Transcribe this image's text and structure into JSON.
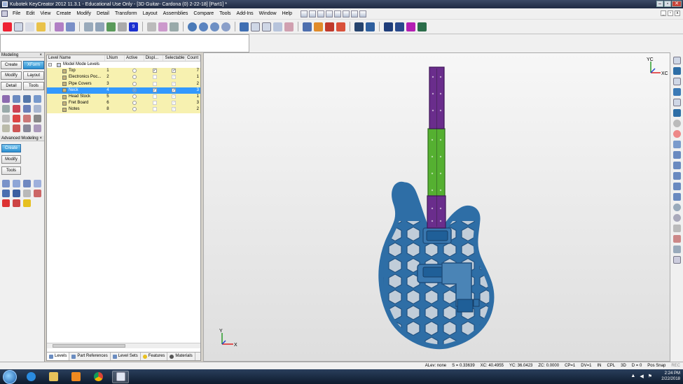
{
  "window": {
    "title": "Kubotek KeyCreator 2012 11.3.1 - Educational Use Only - [3D Guitar- Cardona (0) 2-22-18] [Part1] *"
  },
  "menu": [
    "File",
    "Edit",
    "View",
    "Create",
    "Modify",
    "Detail",
    "Transform",
    "Layout",
    "Assemblies",
    "Compare",
    "Tools",
    "Add-Ins",
    "Window",
    "Help"
  ],
  "left_panel": {
    "modeling_title": "Modeling",
    "modeling_buttons": [
      "Create",
      "XForm",
      "Modify",
      "Layout",
      "Detail",
      "Tools"
    ],
    "advanced_title": "Advanced Modeling",
    "advanced_buttons": [
      "Create",
      "Modify",
      "Tools"
    ]
  },
  "levels": {
    "headers": [
      "Level Name",
      "LNum",
      "Active",
      "Displ...",
      "Selectable",
      "Count"
    ],
    "root": "Model Mode Levels",
    "rows": [
      {
        "name": "Top",
        "lnum": "1",
        "count": "7",
        "active": false,
        "display": true,
        "selectable": true
      },
      {
        "name": "Electronics Poc...",
        "lnum": "2",
        "count": "1",
        "active": false,
        "display": false,
        "selectable": false
      },
      {
        "name": "Pipe Covers",
        "lnum": "3",
        "count": "2",
        "active": false,
        "display": false,
        "selectable": false
      },
      {
        "name": "Neck",
        "lnum": "4",
        "count": "3",
        "active": true,
        "display": true,
        "selectable": true
      },
      {
        "name": "Head Stock",
        "lnum": "5",
        "count": "1",
        "active": false,
        "display": false,
        "selectable": false
      },
      {
        "name": "Fret Board",
        "lnum": "6",
        "count": "3",
        "active": false,
        "display": false,
        "selectable": false
      },
      {
        "name": "Notes",
        "lnum": "8",
        "count": "2",
        "active": false,
        "display": false,
        "selectable": false
      }
    ],
    "tabs": [
      "Levels",
      "Part References",
      "Level Sets",
      "Features",
      "Materials"
    ]
  },
  "viewport": {
    "axis_top": {
      "y": "YC",
      "x": "XC"
    },
    "axis_bottom": {
      "y": "Y",
      "x": "X"
    },
    "colors": {
      "body": "#2e6ea6",
      "body_edge": "#1f4f7e",
      "neck_green": "#55b031",
      "neck_purple": "#6a2d8c"
    }
  },
  "status": {
    "items": [
      "ALev: none",
      "S = 0.33639",
      "XC: 40.4955",
      "YC: 36.0423",
      "ZC: 0.0000",
      "CP=1",
      "DV=1",
      "IN",
      "CPL",
      "3D",
      "D = 0",
      "Pos Snap",
      "REC"
    ]
  },
  "taskbar": {
    "time": "2:24 PM",
    "date": "2/22/2018"
  }
}
